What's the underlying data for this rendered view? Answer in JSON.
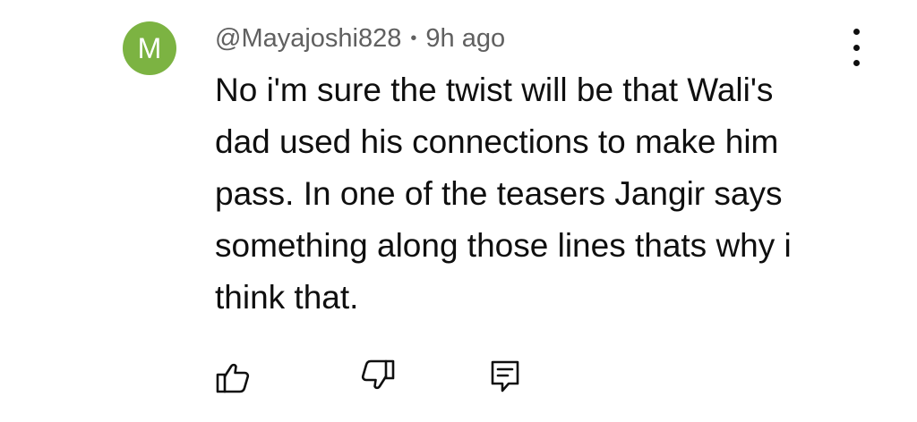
{
  "comment": {
    "avatar_letter": "M",
    "avatar_color": "#7cb342",
    "author": "@Mayajoshi828",
    "separator": "•",
    "time": "9h ago",
    "text_lines": [
      "No i'm sure the twist will be that Wali's",
      "dad used his connections to make him",
      "pass. In one of the teasers Jangir says",
      "something along those lines thats why i",
      "think that."
    ],
    "icons": {
      "more": "more-vertical-icon",
      "like": "thumb-up-icon",
      "dislike": "thumb-down-icon",
      "reply": "comment-reply-icon"
    }
  }
}
